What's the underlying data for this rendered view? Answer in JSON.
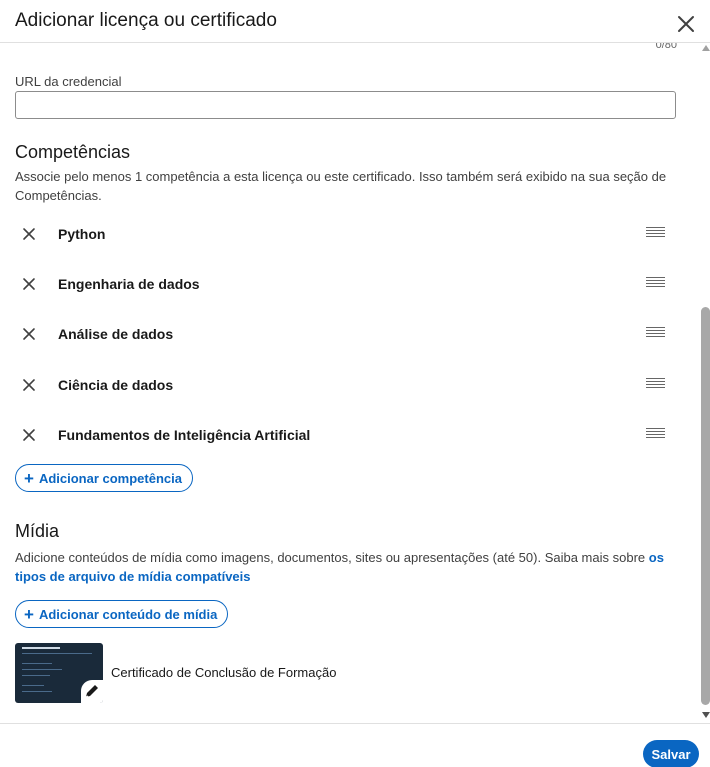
{
  "dialog": {
    "title": "Adicionar licença ou certificado",
    "char_count": "0/80"
  },
  "credential_url": {
    "label": "URL da credencial",
    "value": ""
  },
  "skills": {
    "title": "Competências",
    "description": "Associe pelo menos 1 competência a esta licença ou este certificado. Isso também será exibido na sua seção de Competências.",
    "items": [
      {
        "label": "Python"
      },
      {
        "label": "Engenharia de dados"
      },
      {
        "label": "Análise de dados"
      },
      {
        "label": "Ciência de dados"
      },
      {
        "label": "Fundamentos de Inteligência Artificial"
      }
    ],
    "add_button": "Adicionar competência"
  },
  "media": {
    "title": "Mídia",
    "description": "Adicione conteúdos de mídia como imagens, documentos, sites ou apresentações (até 50). Saiba mais sobre ",
    "link_text": "os tipos de arquivo de mídia compatíveis",
    "add_button": "Adicionar conteúdo de mídia",
    "items": [
      {
        "label": "Certificado de Conclusão de Formação"
      }
    ]
  },
  "footer": {
    "save_label": "Salvar"
  },
  "colors": {
    "accent": "#0a66c2",
    "text": "#191919",
    "border": "#8c8c8c"
  }
}
